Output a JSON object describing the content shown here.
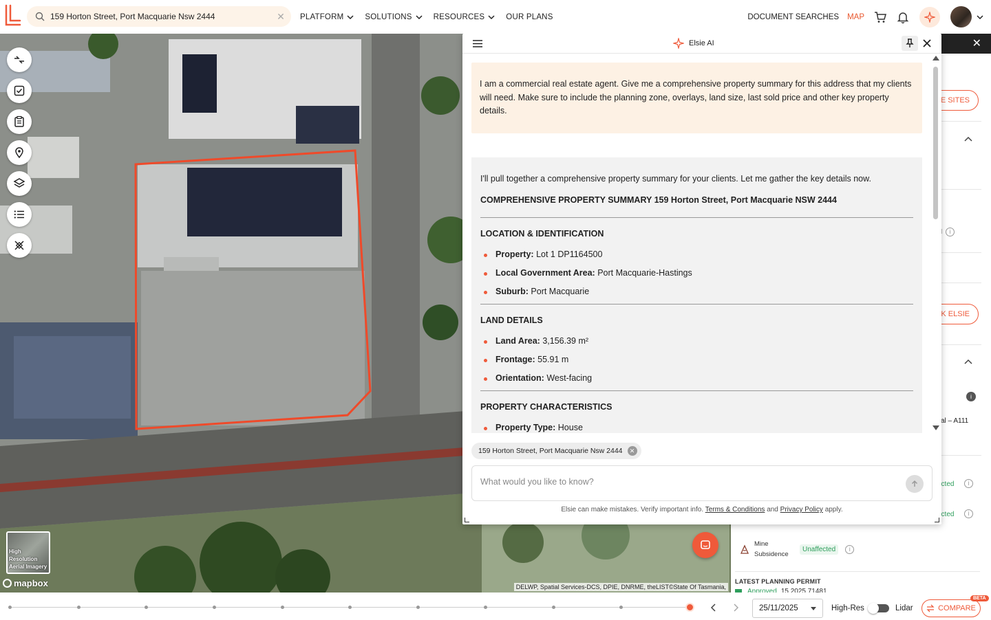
{
  "header": {
    "search_value": "159 Horton Street, Port Macquarie Nsw 2444",
    "nav": [
      "PLATFORM",
      "SOLUTIONS",
      "RESOURCES",
      "OUR PLANS"
    ],
    "document_searches": "DOCUMENT SEARCHES",
    "map": "MAP"
  },
  "map": {
    "hires_label": "High Resolution Aerial Imagery",
    "mapbox": "mapbox",
    "attribution": "DELWP, Spatial Services-DCS, DPIE, DNRME, theLIST©State Of Tasmania,"
  },
  "side": {
    "sites_btn": "TE SITES",
    "ask_btn": "SK ELSIE",
    "frag_e": "e",
    "frag_n": "N",
    "frag_al": "al – A111",
    "frag_ected1": "ected",
    "frag_ected2": "ected",
    "mine_label": "Mine Subsidence",
    "unaffected": "Unaffected",
    "latest_permit": "LATEST PLANNING PERMIT",
    "approved": "Approved",
    "permit_no": "15.2025.71481"
  },
  "elsie": {
    "title": "Elsie AI",
    "user_message": "I am a commercial real estate agent. Give me a comprehensive property summary for this address that my clients will need. Make sure to include the planning zone, overlays, land size, last sold price and other key property details.",
    "ai_intro": "I'll pull together a comprehensive property summary for your clients. Let me gather the key details now.",
    "ai_heading": "COMPREHENSIVE PROPERTY SUMMARY 159 Horton Street, Port Macquarie NSW 2444",
    "sections": [
      {
        "title": "LOCATION & IDENTIFICATION",
        "items": [
          {
            "label": "Property:",
            "value": "Lot 1 DP1164500"
          },
          {
            "label": "Local Government Area:",
            "value": "Port Macquarie-Hastings"
          },
          {
            "label": "Suburb:",
            "value": "Port Macquarie"
          }
        ]
      },
      {
        "title": "LAND DETAILS",
        "items": [
          {
            "label": "Land Area:",
            "value": "3,156.39 m²"
          },
          {
            "label": "Frontage:",
            "value": "55.91 m"
          },
          {
            "label": "Orientation:",
            "value": "West-facing"
          }
        ]
      },
      {
        "title": "PROPERTY CHARACTERISTICS",
        "items": [
          {
            "label": "Property Type:",
            "value": "House"
          }
        ]
      }
    ],
    "chip": "159 Horton Street, Port Macquarie Nsw 2444",
    "input_placeholder": "What would you like to know?",
    "disclaimer_pre": "Elsie can make mistakes. Verify important info.",
    "terms": "Terms & Conditions",
    "and": "and",
    "privacy": "Privacy Policy",
    "apply": "apply."
  },
  "bottom": {
    "date": "25/11/2025",
    "hires": "High-Res",
    "lidar": "Lidar",
    "compare": "COMPARE",
    "beta": "BETA"
  },
  "colors": {
    "accent": "#ef5a3a",
    "user_bubble": "#fdf1e4",
    "ai_bubble": "#f2f2f2"
  }
}
